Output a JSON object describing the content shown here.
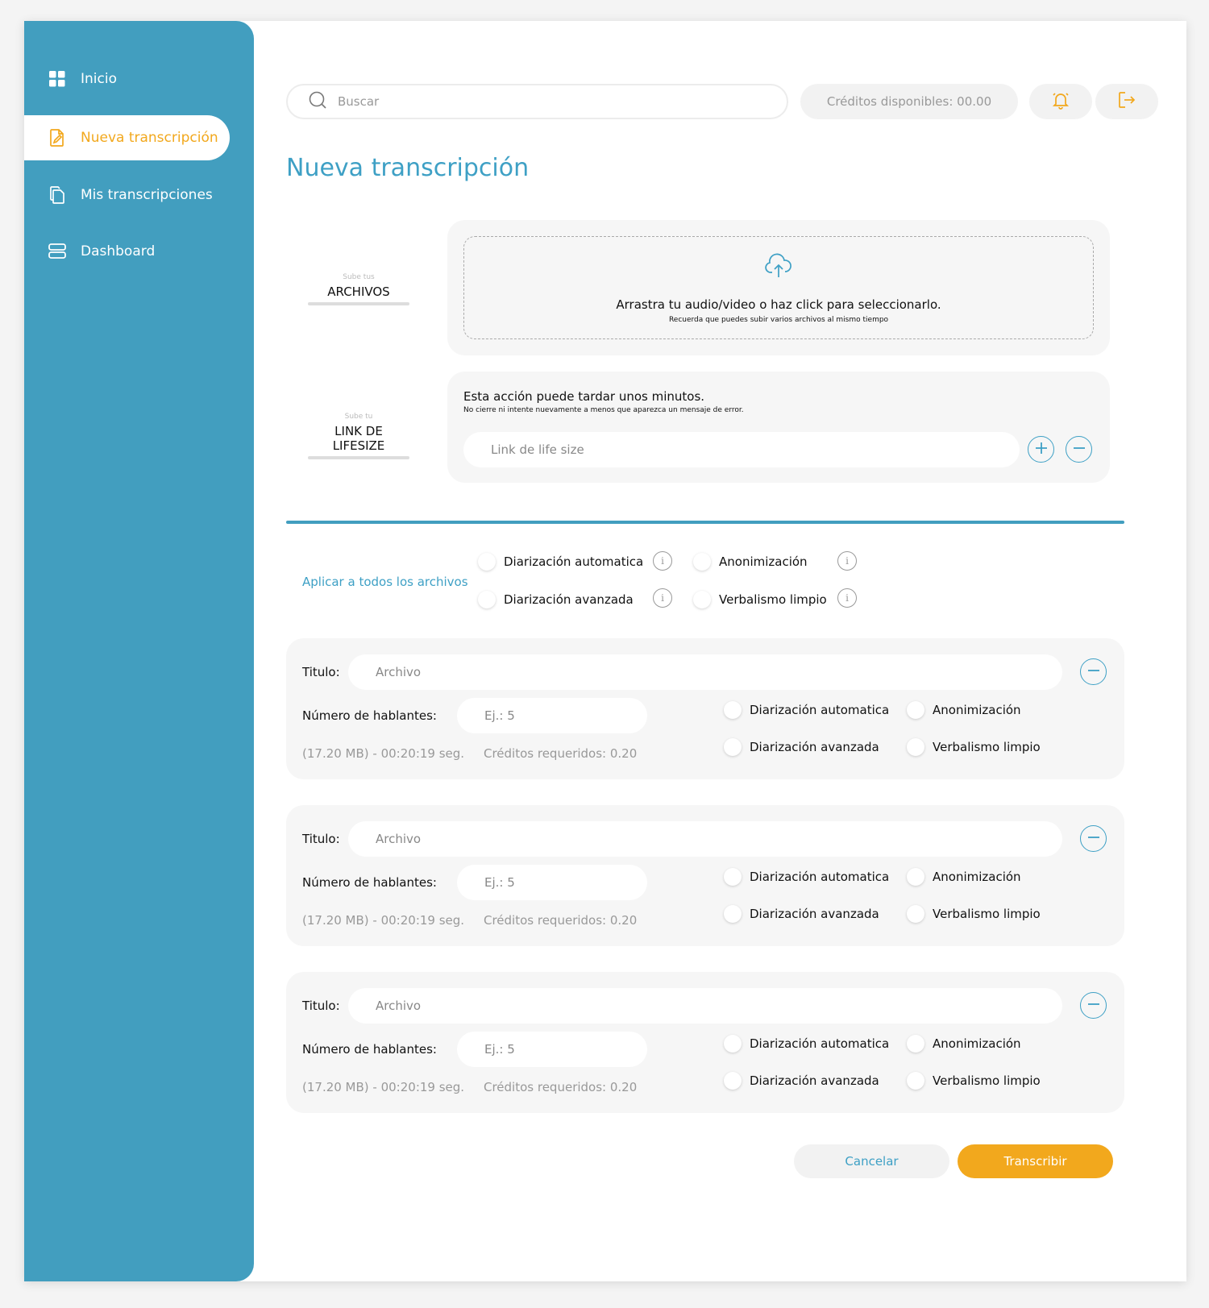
{
  "sidebar": {
    "items": [
      {
        "label": "Inicio",
        "icon": "grid-icon"
      },
      {
        "label": "Nueva transcripción",
        "icon": "file-edit-icon",
        "active": true
      },
      {
        "label": "Mis transcripciones",
        "icon": "files-copy-icon"
      },
      {
        "label": "Dashboard",
        "icon": "server-icon"
      }
    ]
  },
  "header": {
    "search_placeholder": "Buscar",
    "credits_label": "Créditos disponibles: 00.00"
  },
  "page_title": "Nueva transcripción",
  "upload": {
    "files_small": "Sube tus",
    "files_big": "ARCHIVOS",
    "drop_text": "Arrastra tu audio/video o haz click para seleccionarlo.",
    "drop_subtext": "Recuerda que puedes subir varios archivos al mismo tiempo",
    "link_small": "Sube tu",
    "link_big": "LINK DE LIFESIZE",
    "link_title": "Esta acción puede tardar unos minutos.",
    "link_subtitle": "No cierre ni intente nuevamente a menos que aparezca un mensaje de error.",
    "link_placeholder": "Link de life size"
  },
  "apply_all": {
    "label": "Aplicar a todos los archivos",
    "options": [
      "Diarización automatica",
      "Anonimización",
      "Diarización avanzada",
      "Verbalismo limpio"
    ]
  },
  "file_cards": [
    {
      "title_label": "Titulo:",
      "title_placeholder": "Archivo",
      "speakers_label": "Número de hablantes:",
      "speakers_placeholder": "Ej.: 5",
      "size_duration": "(17.20 MB) - 00:20:19 seg.",
      "credits_required": "Créditos requeridos: 0.20",
      "options": [
        "Diarización automatica",
        "Anonimización",
        "Diarización avanzada",
        "Verbalismo limpio"
      ]
    },
    {
      "title_label": "Titulo:",
      "title_placeholder": "Archivo",
      "speakers_label": "Número de hablantes:",
      "speakers_placeholder": "Ej.: 5",
      "size_duration": "(17.20 MB) - 00:20:19 seg.",
      "credits_required": "Créditos requeridos: 0.20",
      "options": [
        "Diarización automatica",
        "Anonimización",
        "Diarización avanzada",
        "Verbalismo limpio"
      ]
    },
    {
      "title_label": "Titulo:",
      "title_placeholder": "Archivo",
      "speakers_label": "Número de hablantes:",
      "speakers_placeholder": "Ej.: 5",
      "size_duration": "(17.20 MB) - 00:20:19 seg.",
      "credits_required": "Créditos requeridos: 0.20",
      "options": [
        "Diarización automatica",
        "Anonimización",
        "Diarización avanzada",
        "Verbalismo limpio"
      ]
    }
  ],
  "actions": {
    "cancel_label": "Cancelar",
    "submit_label": "Transcribir"
  },
  "colors": {
    "primary": "#429ebf",
    "accent": "#f2a81d",
    "panel": "#f6f6f6"
  }
}
